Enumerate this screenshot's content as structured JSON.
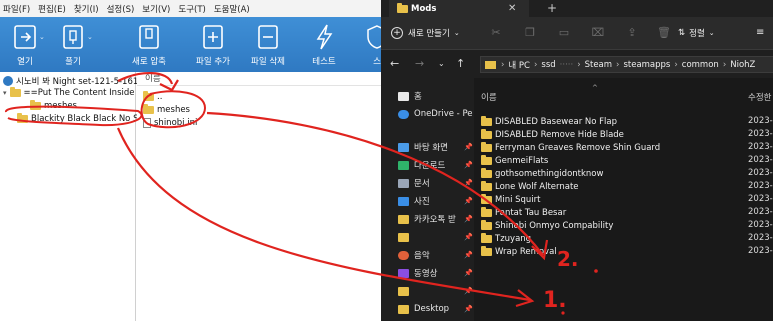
{
  "archive_app": {
    "menu": [
      "파일(F)",
      "편집(E)",
      "찾기(I)",
      "설정(S)",
      "보기(V)",
      "도구(T)",
      "도움말(A)"
    ],
    "toolbar": [
      {
        "label": "열기",
        "icon": "open-folder-icon"
      },
      {
        "label": "풀기",
        "icon": "extract-icon"
      },
      {
        "label": "새로 압축",
        "icon": "new-archive-icon"
      },
      {
        "label": "파일 추가",
        "icon": "add-file-icon"
      },
      {
        "label": "파일 삭제",
        "icon": "delete-file-icon"
      },
      {
        "label": "테스트",
        "icon": "test-icon"
      },
      {
        "label": "스",
        "icon": "shield-icon"
      }
    ],
    "tree": {
      "root": "시노비 봐 Night set-121-5-161",
      "child": "==Put The Content Inside T",
      "meshes": "meshes",
      "selected": "Blackity Black Black No Se"
    },
    "filelist": {
      "header": "이름",
      "items": [
        {
          "name": "..",
          "icon": "folder-up-icon"
        },
        {
          "name": "meshes",
          "icon": "folder-icon"
        },
        {
          "name": "shinobi.ini",
          "icon": "ini-file-icon"
        }
      ]
    }
  },
  "explorer": {
    "tab_title": "Mods",
    "new_button": "새로 만들기",
    "sort_button": "정렬",
    "address": [
      "내 PC",
      "ssd",
      "Steam",
      "steamapps",
      "common",
      "NiohZ"
    ],
    "nav": [
      {
        "label": "홈",
        "icon": "home-icon"
      },
      {
        "label": "OneDrive - Pe",
        "icon": "cloud-icon"
      },
      {
        "label": "바탕 화면",
        "icon": "desktop-icon"
      },
      {
        "label": "다운로드",
        "icon": "download-icon"
      },
      {
        "label": "문서",
        "icon": "document-icon"
      },
      {
        "label": "사진",
        "icon": "picture-icon"
      },
      {
        "label": "카카오톡 받",
        "icon": "folder-icon"
      },
      {
        "label": "",
        "icon": "folder-icon"
      },
      {
        "label": "음악",
        "icon": "music-icon"
      },
      {
        "label": "동영상",
        "icon": "video-icon"
      },
      {
        "label": "",
        "icon": "folder-icon"
      },
      {
        "label": "Desktop",
        "icon": "folder-icon"
      }
    ],
    "columns": {
      "name": "이름",
      "date": "수정한"
    },
    "rows": [
      {
        "name": "DISABLED Basewear No Flap",
        "date": "2023-0"
      },
      {
        "name": "DISABLED Remove Hide Blade",
        "date": "2023-0"
      },
      {
        "name": "Ferryman Greaves Remove Shin Guard",
        "date": "2023-0"
      },
      {
        "name": "GenmeiFlats",
        "date": "2023-0"
      },
      {
        "name": "gothsomethingidontknow",
        "date": "2023-0"
      },
      {
        "name": "Lone Wolf Alternate",
        "date": "2023-0"
      },
      {
        "name": "Mini Squirt",
        "date": "2023-0"
      },
      {
        "name": "Pantat Tau Besar",
        "date": "2023-0"
      },
      {
        "name": "Shinobi Onmyo Compability",
        "date": "2023-0"
      },
      {
        "name": "Tzuyang",
        "date": "2023-0"
      },
      {
        "name": "Wrap Removal",
        "date": "2023-0"
      }
    ]
  },
  "annotations": {
    "label_1": "1.",
    "label_2": "2."
  },
  "colors": {
    "annotation_red": "#e0241f",
    "toolbar_blue": "#3a86cf",
    "folder_yellow": "#e8c14a",
    "explorer_bg": "#191919"
  }
}
